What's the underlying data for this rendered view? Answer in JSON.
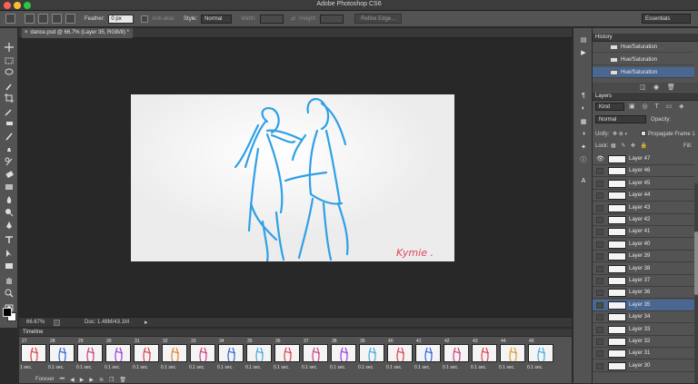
{
  "app": {
    "window_title": "Adobe Photoshop CS6"
  },
  "options_bar": {
    "feather_label": "Feather:",
    "feather_value": "0 px",
    "antialias_label": "Anti-alias",
    "style_label": "Style:",
    "style_value": "Normal",
    "width_label": "Width:",
    "height_label": "Height:",
    "refine_edge_label": "Refine Edge...",
    "workspace_value": "Essentials"
  },
  "document": {
    "tab_title": "dance.psd @ 66.7% (Layer 35, RGB/8) *",
    "signature_text": "Kymie ."
  },
  "status_bar": {
    "zoom": "66.67%",
    "doc_info": "Doc: 1.48M/43.1M"
  },
  "timeline": {
    "title": "Timeline",
    "loop_value": "Forever",
    "frames": [
      {
        "num": "27",
        "delay": "1 sec."
      },
      {
        "num": "28",
        "delay": "0.1 sec."
      },
      {
        "num": "29",
        "delay": "0.1 sec."
      },
      {
        "num": "30",
        "delay": "0.1 sec."
      },
      {
        "num": "31",
        "delay": "0.1 sec."
      },
      {
        "num": "32",
        "delay": "0.1 sec."
      },
      {
        "num": "33",
        "delay": "0.1 sec."
      },
      {
        "num": "34",
        "delay": "0.1 sec."
      },
      {
        "num": "35",
        "delay": "0.1 sec."
      },
      {
        "num": "36",
        "delay": "0.1 sec."
      },
      {
        "num": "37",
        "delay": "0.1 sec."
      },
      {
        "num": "38",
        "delay": "0.1 sec."
      },
      {
        "num": "39",
        "delay": "0.1 sec."
      },
      {
        "num": "40",
        "delay": "0.1 sec."
      },
      {
        "num": "41",
        "delay": "0.1 sec."
      },
      {
        "num": "42",
        "delay": "0.1 sec."
      },
      {
        "num": "43",
        "delay": "0.1 sec."
      },
      {
        "num": "44",
        "delay": "0.1 sec."
      },
      {
        "num": "45",
        "delay": "0.1 sec."
      }
    ]
  },
  "history": {
    "title": "History",
    "items": [
      {
        "label": "Hue/Saturation",
        "selected": false
      },
      {
        "label": "Hue/Saturation",
        "selected": false
      },
      {
        "label": "Hue/Saturation",
        "selected": true
      }
    ]
  },
  "layers_panel": {
    "title": "Layers",
    "filter_value": "Kind",
    "blend_mode": "Normal",
    "opacity_label": "Opacity:",
    "unify_label": "Unify:",
    "propagate_label": "Propagate Frame 1",
    "lock_label": "Lock:",
    "fill_label": "Fill:",
    "layers": [
      {
        "name": "Layer 47",
        "visible": true,
        "selected": false
      },
      {
        "name": "Layer 46",
        "visible": false,
        "selected": false
      },
      {
        "name": "Layer 45",
        "visible": false,
        "selected": false
      },
      {
        "name": "Layer 44",
        "visible": false,
        "selected": false
      },
      {
        "name": "Layer 43",
        "visible": false,
        "selected": false
      },
      {
        "name": "Layer 42",
        "visible": false,
        "selected": false
      },
      {
        "name": "Layer 41",
        "visible": false,
        "selected": false
      },
      {
        "name": "Layer 40",
        "visible": false,
        "selected": false
      },
      {
        "name": "Layer 39",
        "visible": false,
        "selected": false
      },
      {
        "name": "Layer 38",
        "visible": false,
        "selected": false
      },
      {
        "name": "Layer 37",
        "visible": false,
        "selected": false
      },
      {
        "name": "Layer 36",
        "visible": false,
        "selected": false
      },
      {
        "name": "Layer 35",
        "visible": false,
        "selected": true
      },
      {
        "name": "Layer 34",
        "visible": false,
        "selected": false
      },
      {
        "name": "Layer 33",
        "visible": false,
        "selected": false
      },
      {
        "name": "Layer 32",
        "visible": false,
        "selected": false
      },
      {
        "name": "Layer 31",
        "visible": false,
        "selected": false
      },
      {
        "name": "Layer 30",
        "visible": false,
        "selected": false
      }
    ]
  },
  "colors": {
    "sketch_blue": "#2fa0e6",
    "signature_red": "#e0455a",
    "selection": "#4a6791"
  },
  "thumb_colors": [
    "#e04a5a",
    "#3a6fd8",
    "#d04a8a",
    "#a04ad8",
    "#e04a5a",
    "#e08a3a",
    "#d04a8a",
    "#3a6fd8",
    "#4ab0e0",
    "#e04a5a",
    "#d04a8a",
    "#a04ad8",
    "#4ab0e0",
    "#e04a5a",
    "#3a6fd8",
    "#d04a8a",
    "#e04a5a",
    "#e0a03a",
    "#4ab0e0"
  ]
}
